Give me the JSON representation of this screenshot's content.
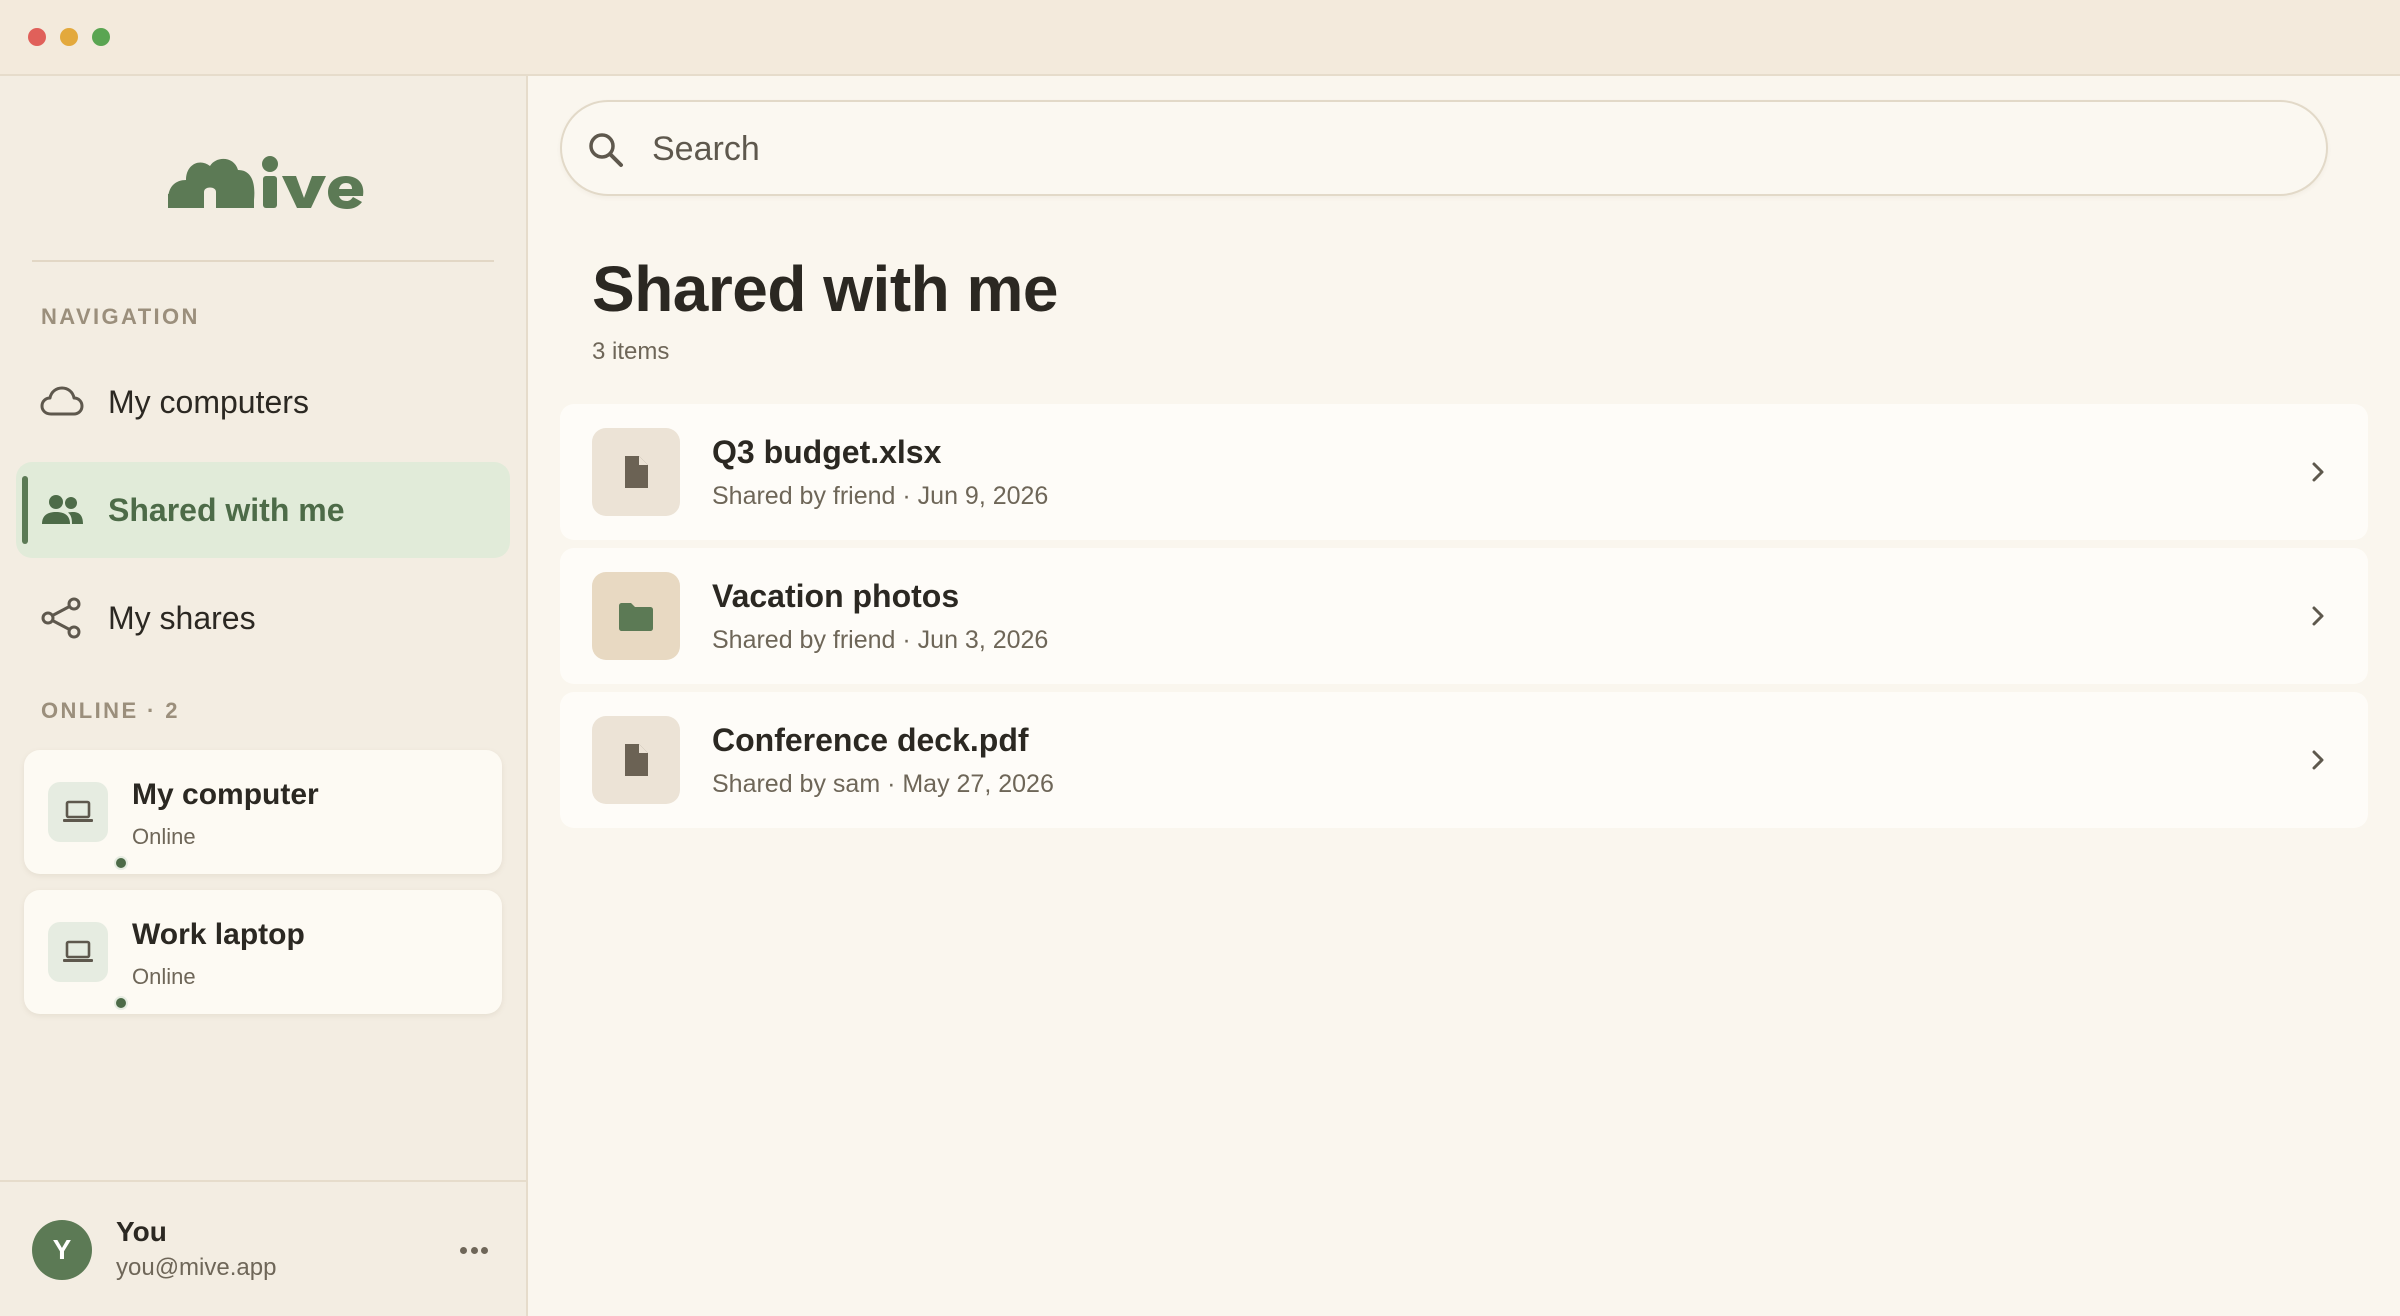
{
  "window": {
    "controls": [
      "close",
      "minimize",
      "maximize"
    ]
  },
  "sidebar": {
    "logo_text": "mive",
    "navigation_label": "NAVIGATION",
    "nav_items": [
      {
        "label": "My computers",
        "icon": "cloud-icon",
        "active": false
      },
      {
        "label": "Shared with me",
        "icon": "people-icon",
        "active": true
      },
      {
        "label": "My shares",
        "icon": "share-icon",
        "active": false
      }
    ],
    "online_label": "ONLINE · 2",
    "devices": [
      {
        "name": "My computer",
        "status": "Online",
        "icon": "laptop-icon"
      },
      {
        "name": "Work laptop",
        "status": "Online",
        "icon": "laptop-icon"
      }
    ],
    "user": {
      "initial": "Y",
      "name": "You",
      "email": "you@mive.app"
    }
  },
  "search": {
    "placeholder": "Search"
  },
  "main": {
    "title": "Shared with me",
    "count": "3 items",
    "items": [
      {
        "name": "Q3 budget.xlsx",
        "meta": "Shared by friend · Jun 9, 2026",
        "icon": "file-icon"
      },
      {
        "name": "Vacation photos",
        "meta": "Shared by friend · Jun 3, 2026",
        "icon": "folder-icon"
      },
      {
        "name": "Conference deck.pdf",
        "meta": "Shared by sam · May 27, 2026",
        "icon": "file-icon"
      }
    ]
  },
  "colors": {
    "accent": "#5c7a55",
    "active_bg": "#e1ebd9",
    "sidebar_bg": "#f3ede2",
    "main_bg": "#faf6ee"
  }
}
